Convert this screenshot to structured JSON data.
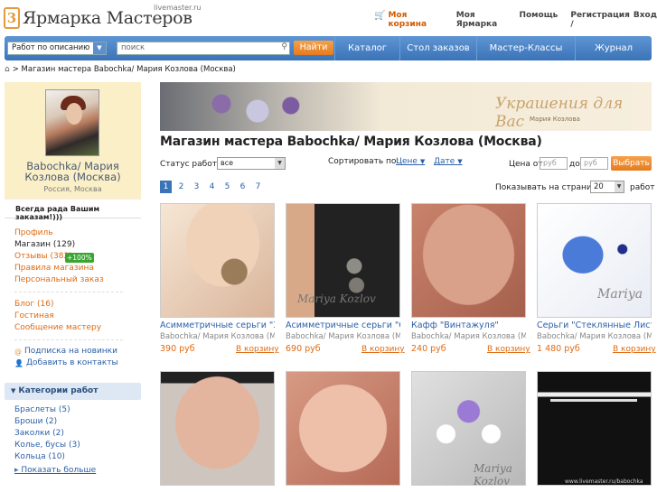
{
  "header": {
    "logo_mark": "3",
    "logo_text": "Ярмарка Мастеров",
    "logo_sub": "livemaster.ru",
    "cart": "Моя корзина",
    "my_fair": "Моя Ярмарка",
    "help": "Помощь",
    "register": "Регистрация /",
    "login": "Вход"
  },
  "nav": {
    "filter_value": "Работ по описанию",
    "search_placeholder": "поиск",
    "find_button": "Найти",
    "items": [
      "Каталог",
      "Стол заказов",
      "Мастер-Классы",
      "Журнал"
    ]
  },
  "breadcrumb": "> Магазин мастера Babochka/ Мария Козлова (Москва)",
  "profile": {
    "name": "Babochka/ Мария Козлова (Москва)",
    "city": "Россия, Москва",
    "welcome": "Всегда рада Вашим заказам!)))"
  },
  "side_links": {
    "profile": "Профиль",
    "shop": "Магазин (129)",
    "reviews": "Отзывы (382)",
    "reviews_badge": "+100%",
    "rules": "Правила магазина",
    "personal": "Персональный заказ",
    "blog": "Блог (16)",
    "guestbook": "Гостиная",
    "message": "Сообщение мастеру",
    "subscribe": "Подписка на новинки",
    "add_contacts": "Добавить в контакты"
  },
  "categories": {
    "title": "Категории работ",
    "items": [
      "Браслеты (5)",
      "Броши (2)",
      "Заколки (2)",
      "Колье, бусы (3)",
      "Кольца (10)"
    ],
    "more": "Показать больше"
  },
  "banner": {
    "text": "Украшения для Вас",
    "sub": "Мария Козлова"
  },
  "shop_title": "Магазин мастера Babochka/ Мария Козлова (Москва)",
  "controls": {
    "status_label": "Статус работ:",
    "status_value": "все",
    "sort_label": "Сортировать по:",
    "sort_price": "Цене",
    "sort_date": "Дате",
    "price_from_label": "Цена от",
    "price_placeholder": "руб",
    "price_to_label": "до",
    "choose_button": "Выбрать",
    "per_page_label": "Показывать на странице",
    "per_page_value": "20",
    "per_page_after": "работ"
  },
  "pages": [
    "1",
    "2",
    "3",
    "4",
    "5",
    "6",
    "7"
  ],
  "current_page": "1",
  "products": [
    {
      "title": "Асимметричные серьги \"Зо",
      "author": "Babochka/ Мария Козлова (Мо",
      "price": "390 руб",
      "cart": "В корзину"
    },
    {
      "title": "Асимметричные серьги \"Сн",
      "author": "Babochka/ Мария Козлова (Мо",
      "price": "690 руб",
      "cart": "В корзину"
    },
    {
      "title": "Кафф \"Винтажуля\"",
      "author": "Babochka/ Мария Козлова (Мо",
      "price": "240 руб",
      "cart": "В корзину"
    },
    {
      "title": "Серьги \"Стеклянные Лист",
      "author": "Babochka/ Мария Козлова (Мо",
      "price": "1 480 руб",
      "cart": "В корзину"
    }
  ],
  "watermarks": [
    "Mariya Kozlov",
    "Mariya",
    "Mariya Kozlov",
    "www.livemaster.ru/babochka"
  ],
  "icons": {
    "cart": "cart-icon",
    "home": "home-icon",
    "search": "search-icon"
  },
  "colors": {
    "accent_orange": "#e57c1e",
    "nav_blue": "#3b73b8",
    "link_blue": "#2a5fa8",
    "profile_bg": "#fbefc7",
    "badge_green": "#38a630"
  }
}
